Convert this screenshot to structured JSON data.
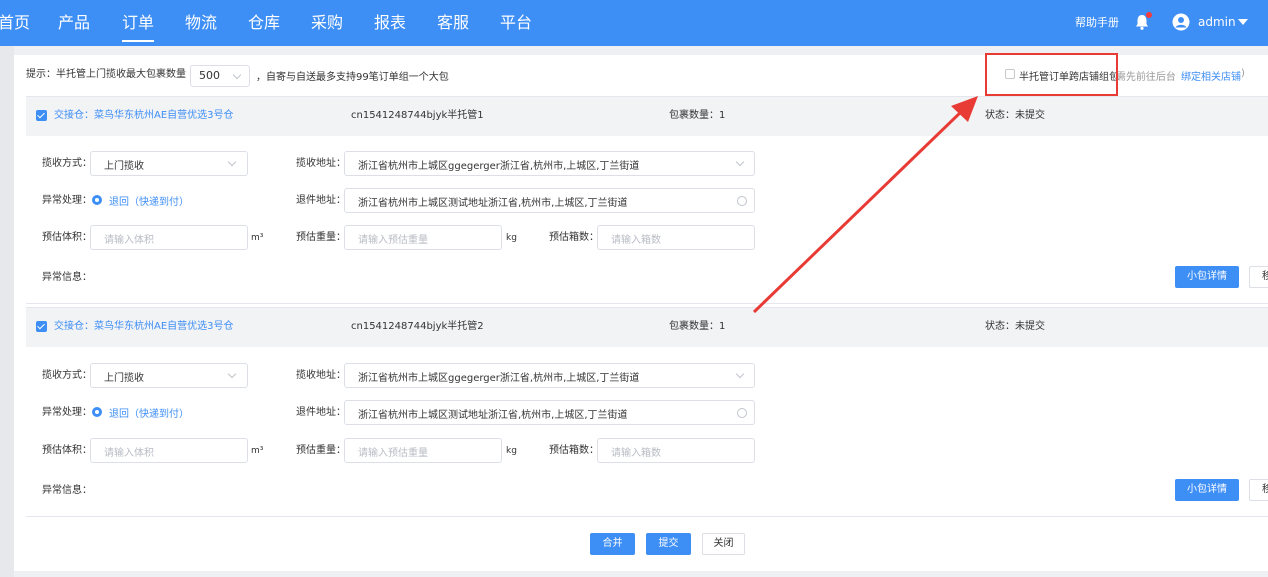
{
  "nav": {
    "items": [
      "首页",
      "产品",
      "订单",
      "物流",
      "仓库",
      "采购",
      "报表",
      "客服",
      "平台"
    ],
    "active_index": 2,
    "help": "帮助手册",
    "user": "admin"
  },
  "tip": {
    "prefix": "提示：半托管上门揽收最大包裹数量",
    "select_value": "500",
    "suffix": "，自寄与自送最多支持99笔订单组一个大包"
  },
  "cross_store": {
    "label": "半托管订单跨店铺组包",
    "hint": "(需先前往后台",
    "link": "绑定相关店铺",
    "close": ")"
  },
  "blocks": [
    {
      "warehouse": "交接仓：菜鸟华东杭州AE自营优选3号仓",
      "order_no": "cn1541248744bjyk半托管1",
      "package_count": "包裹数量：1",
      "status": "状态：未提交",
      "pickup_method_label": "揽收方式：",
      "pickup_method": "上门揽收",
      "pickup_addr_label": "揽收地址：",
      "pickup_addr": "浙江省杭州市上城区ggegerger浙江省,杭州市,上城区,丁兰街道",
      "exception_label": "异常处理：",
      "exception_option": "退回（快递到付）",
      "return_addr_label": "退件地址：",
      "return_addr": "浙江省杭州市上城区测试地址浙江省,杭州市,上城区,丁兰街道",
      "volume_label": "预估体积：",
      "volume_ph": "请输入体积",
      "volume_unit": "m³",
      "weight_label": "预估重量：",
      "weight_ph": "请输入预估重量",
      "weight_unit": "kg",
      "boxes_label": "预估箱数：",
      "boxes_ph": "请输入箱数",
      "error_label": "异常信息：",
      "detail_btn": "小包详情",
      "cut_btn": "移"
    },
    {
      "warehouse": "交接仓：菜鸟华东杭州AE自营优选3号仓",
      "order_no": "cn1541248744bjyk半托管2",
      "package_count": "包裹数量：1",
      "status": "状态：未提交",
      "pickup_method_label": "揽收方式：",
      "pickup_method": "上门揽收",
      "pickup_addr_label": "揽收地址：",
      "pickup_addr": "浙江省杭州市上城区ggegerger浙江省,杭州市,上城区,丁兰街道",
      "exception_label": "异常处理：",
      "exception_option": "退回（快递到付）",
      "return_addr_label": "退件地址：",
      "return_addr": "浙江省杭州市上城区测试地址浙江省,杭州市,上城区,丁兰街道",
      "volume_label": "预估体积：",
      "volume_ph": "请输入体积",
      "volume_unit": "m³",
      "weight_label": "预估重量：",
      "weight_ph": "请输入预估重量",
      "weight_unit": "kg",
      "boxes_label": "预估箱数：",
      "boxes_ph": "请输入箱数",
      "error_label": "异常信息：",
      "detail_btn": "小包详情",
      "cut_btn": "移"
    }
  ],
  "footer": {
    "merge": "合并",
    "submit": "提交",
    "close": "关闭"
  },
  "colors": {
    "primary": "#3d8ef5",
    "annotation": "#e83b36"
  }
}
